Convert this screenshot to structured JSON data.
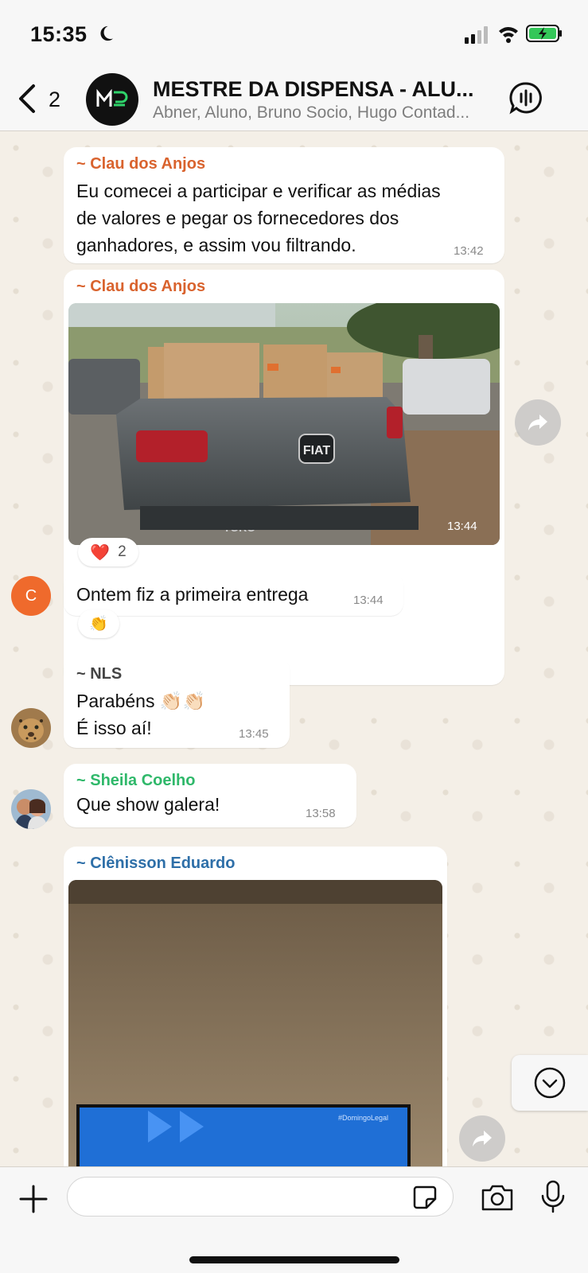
{
  "status": {
    "time": "15:35"
  },
  "header": {
    "back_count": "2",
    "title": "MESTRE DA DISPENSA - ALU...",
    "subtitle": "Abner, Aluno, Bruno Socio, Hugo Contad..."
  },
  "messages": [
    {
      "sender": "~ Clau dos Anjos",
      "sender_color": "#d9632e",
      "lines": [
        "Eu comecei a participar e verificar as médias",
        "de valores e pegar os fornecedores dos",
        "ganhadores, e assim vou filtrando."
      ],
      "time": "13:42"
    },
    {
      "sender": "~ Clau dos Anjos",
      "sender_color": "#d9632e",
      "photo_brand": "FIAT",
      "photo_model": "TORO",
      "time": "13:44",
      "reaction_emoji": "❤️",
      "reaction_count": "2"
    },
    {
      "avatar_letter": "C",
      "avatar_color": "#ef6a2c",
      "text": "Ontem fiz a primeira entrega",
      "time": "13:44",
      "reaction_emoji": "👏"
    },
    {
      "sender": "~ NLS",
      "sender_color": "#444444",
      "line1": "Parabéns 👏🏻👏🏻",
      "line2": "É isso aí!",
      "time": "13:45"
    },
    {
      "sender": "~ Sheila Coelho",
      "sender_color": "#2fb86a",
      "text": "Que show galera!",
      "time": "13:58"
    },
    {
      "sender": "~ Clênisson Eduardo",
      "sender_color": "#2e6fa8",
      "tv_caption": "#DomingoLegal"
    }
  ],
  "input": {
    "placeholder": ""
  },
  "colors": {
    "incoming_bubble": "#ffffff",
    "chat_bg": "#f4efe7",
    "battery": "#34c759"
  }
}
